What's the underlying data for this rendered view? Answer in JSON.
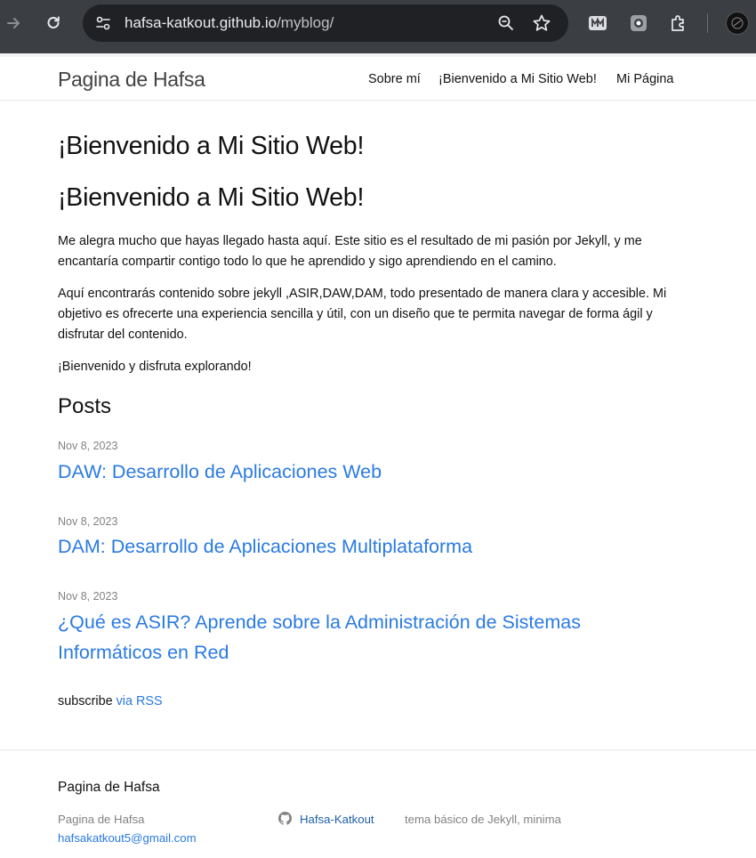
{
  "browser": {
    "url_host": "hafsa-katkout.github.io",
    "url_path": "/myblog/",
    "icons": [
      "forward-icon",
      "reload-icon",
      "site-info-icon",
      "zoom-icon",
      "bookmark-star-icon",
      "extension-m-icon",
      "extension-camera-icon",
      "extensions-puzzle-icon",
      "profile-avatar"
    ]
  },
  "header": {
    "site_title": "Pagina de Hafsa",
    "nav": [
      {
        "label": "Sobre mí"
      },
      {
        "label": "¡Bienvenido a Mi Sitio Web!"
      },
      {
        "label": "Mi Página"
      }
    ]
  },
  "main": {
    "page_title": "¡Bienvenido a Mi Sitio Web!",
    "heading": "¡Bienvenido a Mi Sitio Web!",
    "paragraphs": [
      "Me alegra mucho que hayas llegado hasta aquí. Este sitio es el resultado de mi pasión por Jekyll, y me encantaría compartir contigo todo lo que he aprendido y sigo aprendiendo en el camino.",
      "Aquí encontrarás contenido sobre jekyll ,ASIR,DAW,DAM, todo presentado de manera clara y accesible. Mi objetivo es ofrecerte una experiencia sencilla y útil, con un diseño que te permita navegar de forma ágil y disfrutar del contenido.",
      "¡Bienvenido y disfruta explorando!"
    ],
    "posts_heading": "Posts",
    "posts": [
      {
        "date": "Nov 8, 2023",
        "title": "DAW: Desarrollo de Aplicaciones Web"
      },
      {
        "date": "Nov 8, 2023",
        "title": "DAM: Desarrollo de Aplicaciones Multiplataforma"
      },
      {
        "date": "Nov 8, 2023",
        "title": "¿Qué es ASIR? Aprende sobre la Administración de Sistemas Informáticos en Red"
      }
    ],
    "subscribe_text": "subscribe",
    "subscribe_link": "via RSS"
  },
  "footer": {
    "heading": "Pagina de Hafsa",
    "name": "Pagina de Hafsa",
    "email": "hafsakatkout5@gmail.com",
    "github_user": "Hafsa-Katkout",
    "description": "tema básico de Jekyll, minima"
  },
  "colors": {
    "browser_bar": "#3b3f44",
    "omnibox": "#1f2124",
    "link": "#2a7ae2",
    "muted": "#828282"
  }
}
